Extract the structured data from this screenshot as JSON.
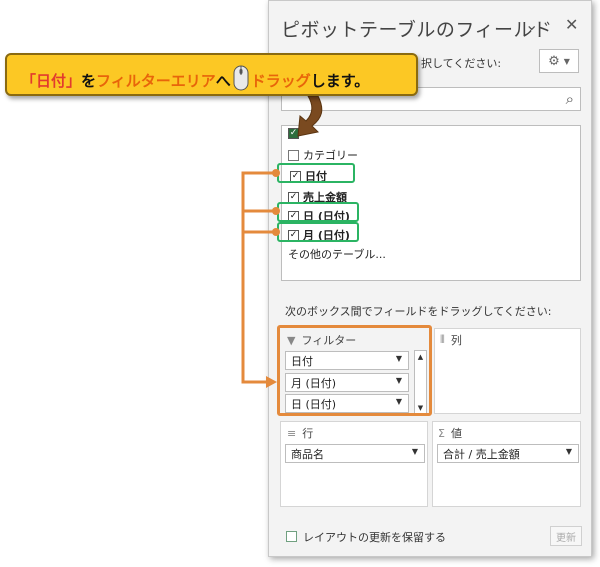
{
  "pane": {
    "title": "ピボットテーブルのフィールド",
    "choose_text": "択してください:",
    "gear_icon": "gear-icon",
    "search_placeholder": ""
  },
  "fields": [
    {
      "label": "カテゴリー",
      "checked": false,
      "bold": false
    },
    {
      "label": "日付",
      "checked": true,
      "bold": true
    },
    {
      "label": "売上金額",
      "checked": true,
      "bold": true
    },
    {
      "label": "日 (日付)",
      "checked": true,
      "bold": true
    },
    {
      "label": "月 (日付)",
      "checked": true,
      "bold": true
    }
  ],
  "more_tables": "その他のテーブル...",
  "drag_instruction": "次のボックス間でフィールドをドラッグしてください:",
  "areas": {
    "filter": {
      "label": "フィルター",
      "items": [
        "日付",
        "月 (日付)",
        "日 (日付)"
      ]
    },
    "columns": {
      "label": "列",
      "items": []
    },
    "rows": {
      "label": "行",
      "items": [
        "商品名"
      ]
    },
    "values": {
      "label": "値",
      "items": [
        "合計 / 売上金額"
      ]
    }
  },
  "footer": {
    "defer_label": "レイアウトの更新を保留する",
    "update_label": "更新"
  },
  "callout": {
    "part1": "「日付」",
    "part2": "を",
    "part3": "フィルターエリア",
    "part4": "へ",
    "part5": "ドラッグ",
    "part6": "します。"
  },
  "colors": {
    "callout_bg": "#fcc824",
    "highlight_orange": "#e8650a",
    "green_frame": "#2bb463",
    "orange_frame": "#e48a3c"
  }
}
